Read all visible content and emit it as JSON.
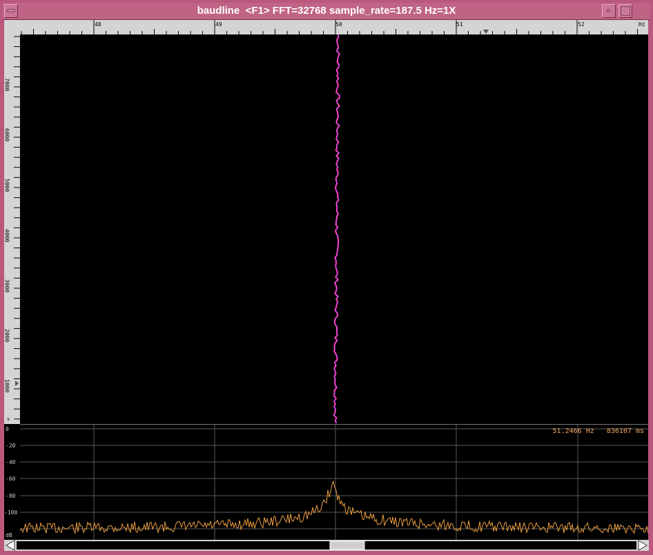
{
  "window": {
    "title": "baudline  <F1> FFT=32768 sample_rate=187.5 Hz=1X"
  },
  "freq_axis": {
    "ticks": [
      "48",
      "49",
      "50",
      "51",
      "52"
    ],
    "unit": "Hz"
  },
  "time_axis": {
    "ticks": [
      "7000",
      "6000",
      "5000",
      "4000",
      "3000",
      "2000",
      "1000"
    ],
    "unit": "s"
  },
  "spectrum": {
    "db_ticks": [
      "0",
      "-20",
      "-40",
      "-60",
      "-80",
      "-100"
    ],
    "db_unit": "dB",
    "readout_freq": "51.2466 Hz",
    "readout_time": "836107 ms"
  },
  "colors": {
    "frame": "#b9587c",
    "trace_waterfall": "#ff44cc",
    "trace_spectrum": "#f0a040",
    "grid": "#5a5a5a"
  }
}
